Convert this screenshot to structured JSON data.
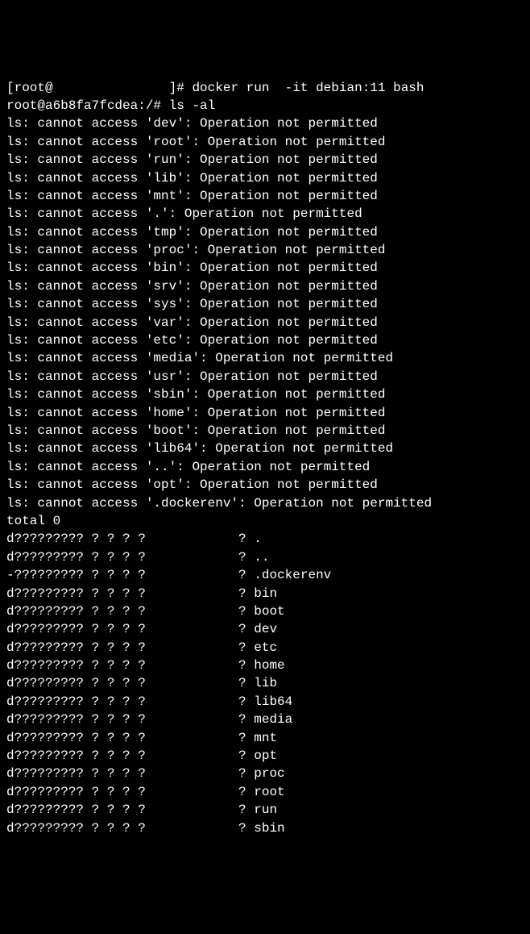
{
  "terminal": {
    "host_prompt_prefix": "[root@",
    "host_prompt_suffix": "]# ",
    "host_command": "docker run  -it debian:11 bash",
    "container_prompt": "root@a6b8fa7fcdea:/# ",
    "container_command": "ls -al",
    "errors": [
      "ls: cannot access 'dev': Operation not permitted",
      "ls: cannot access 'root': Operation not permitted",
      "ls: cannot access 'run': Operation not permitted",
      "ls: cannot access 'lib': Operation not permitted",
      "ls: cannot access 'mnt': Operation not permitted",
      "ls: cannot access '.': Operation not permitted",
      "ls: cannot access 'tmp': Operation not permitted",
      "ls: cannot access 'proc': Operation not permitted",
      "ls: cannot access 'bin': Operation not permitted",
      "ls: cannot access 'srv': Operation not permitted",
      "ls: cannot access 'sys': Operation not permitted",
      "ls: cannot access 'var': Operation not permitted",
      "ls: cannot access 'etc': Operation not permitted",
      "ls: cannot access 'media': Operation not permitted",
      "ls: cannot access 'usr': Operation not permitted",
      "ls: cannot access 'sbin': Operation not permitted",
      "ls: cannot access 'home': Operation not permitted",
      "ls: cannot access 'boot': Operation not permitted",
      "ls: cannot access 'lib64': Operation not permitted",
      "ls: cannot access '..': Operation not permitted",
      "ls: cannot access 'opt': Operation not permitted",
      "ls: cannot access '.dockerenv': Operation not permitted"
    ],
    "total_line": "total 0",
    "listing": [
      "d????????? ? ? ? ?            ? .",
      "d????????? ? ? ? ?            ? ..",
      "-????????? ? ? ? ?            ? .dockerenv",
      "d????????? ? ? ? ?            ? bin",
      "d????????? ? ? ? ?            ? boot",
      "d????????? ? ? ? ?            ? dev",
      "d????????? ? ? ? ?            ? etc",
      "d????????? ? ? ? ?            ? home",
      "d????????? ? ? ? ?            ? lib",
      "d????????? ? ? ? ?            ? lib64",
      "d????????? ? ? ? ?            ? media",
      "d????????? ? ? ? ?            ? mnt",
      "d????????? ? ? ? ?            ? opt",
      "d????????? ? ? ? ?            ? proc",
      "d????????? ? ? ? ?            ? root",
      "d????????? ? ? ? ?            ? run",
      "d????????? ? ? ? ?            ? sbin"
    ]
  }
}
